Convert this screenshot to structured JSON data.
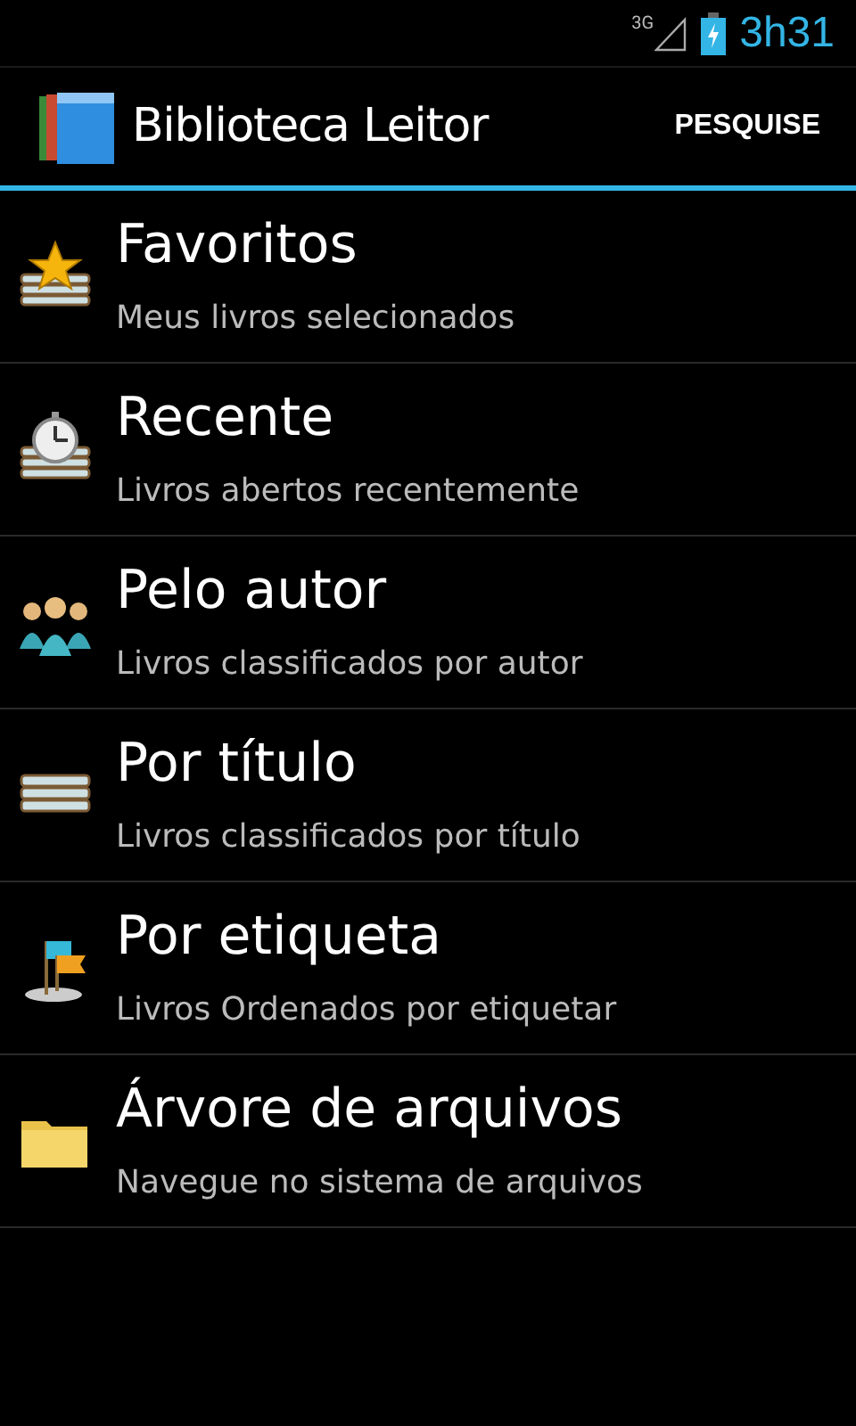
{
  "status_bar": {
    "network": "3G",
    "time": "3h31"
  },
  "action_bar": {
    "title": "Biblioteca Leitor",
    "action": "PESQUISE"
  },
  "items": [
    {
      "kind": "favorites",
      "title": "Favoritos",
      "subtitle": "Meus livros selecionados"
    },
    {
      "kind": "recent",
      "title": "Recente",
      "subtitle": "Livros abertos recentemente"
    },
    {
      "kind": "author",
      "title": "Pelo autor",
      "subtitle": "Livros classificados por autor"
    },
    {
      "kind": "title",
      "title": "Por título",
      "subtitle": "Livros classificados por título"
    },
    {
      "kind": "tag",
      "title": "Por etiqueta",
      "subtitle": "Livros Ordenados por etiquetar"
    },
    {
      "kind": "files",
      "title": "Árvore de arquivos",
      "subtitle": "Navegue no sistema de arquivos"
    }
  ]
}
